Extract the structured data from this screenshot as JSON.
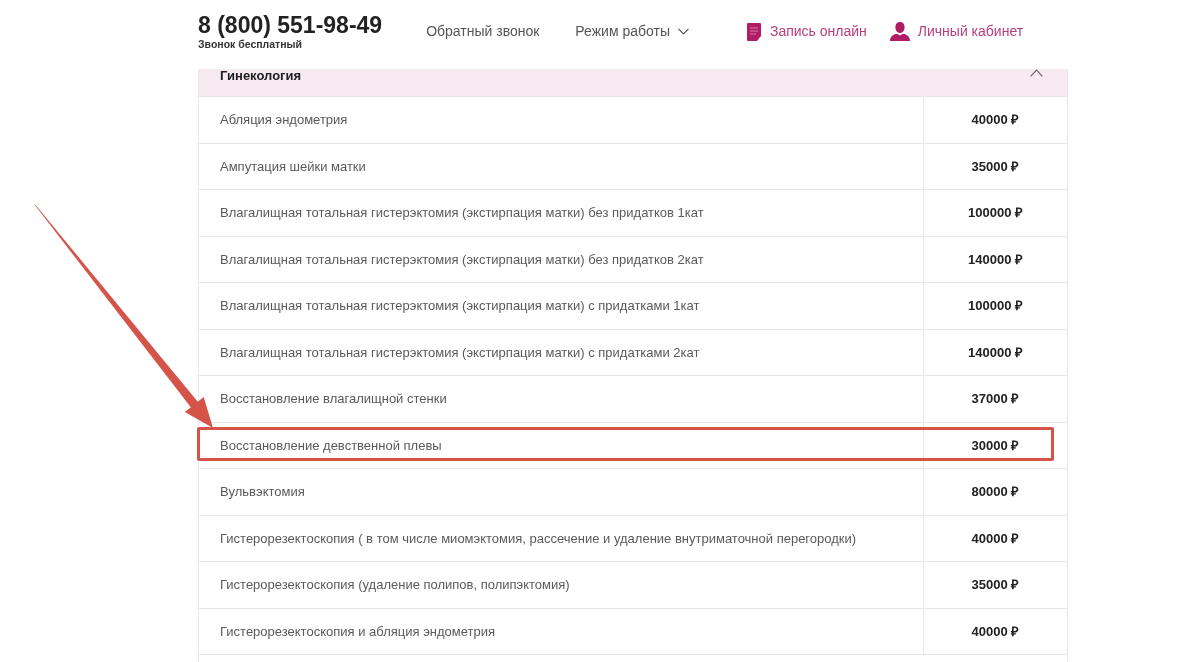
{
  "header": {
    "phone": "8 (800) 551-98-49",
    "phone_note": "Звонок бесплатный",
    "nav": [
      {
        "label": "Обратный звонок",
        "kind": "link"
      },
      {
        "label": "Режим работы",
        "kind": "dropdown"
      }
    ],
    "actions": [
      {
        "label": "Запись онлайн",
        "kind": "booking"
      },
      {
        "label": "Личный кабинет",
        "kind": "account"
      }
    ]
  },
  "section": {
    "title": "Гинекология",
    "expanded": true,
    "rows": [
      {
        "service": "Абляция эндометрия",
        "price": "40000 ₽",
        "highlighted": false
      },
      {
        "service": "Ампутация шейки матки",
        "price": "35000 ₽",
        "highlighted": false
      },
      {
        "service": "Влагалищная тотальная гистерэктомия (экстирпация матки) без придатков 1кат",
        "price": "100000 ₽",
        "highlighted": false
      },
      {
        "service": "Влагалищная тотальная гистерэктомия (экстирпация матки) без придатков 2кат",
        "price": "140000 ₽",
        "highlighted": false
      },
      {
        "service": "Влагалищная тотальная гистерэктомия (экстирпация матки) с придатками 1кат",
        "price": "100000 ₽",
        "highlighted": false
      },
      {
        "service": "Влагалищная тотальная гистерэктомия (экстирпация матки) с придатками 2кат",
        "price": "140000 ₽",
        "highlighted": false
      },
      {
        "service": "Восстановление влагалищной стенки",
        "price": "37000 ₽",
        "highlighted": false
      },
      {
        "service": "Восстановление девственной плевы",
        "price": "30000 ₽",
        "highlighted": true
      },
      {
        "service": "Вульвэктомия",
        "price": "80000 ₽",
        "highlighted": false
      },
      {
        "service": "Гистерорезектоскопия ( в том числе миомэктомия, рассечение и удаление внутриматочной перегородки)",
        "price": "40000 ₽",
        "highlighted": false
      },
      {
        "service": "Гистерорезектоскопия (удаление полипов, полипэктомия)",
        "price": "35000 ₽",
        "highlighted": false
      },
      {
        "service": "Гистерорезектоскопия и абляция эндометрия",
        "price": "40000 ₽",
        "highlighted": false
      }
    ]
  }
}
